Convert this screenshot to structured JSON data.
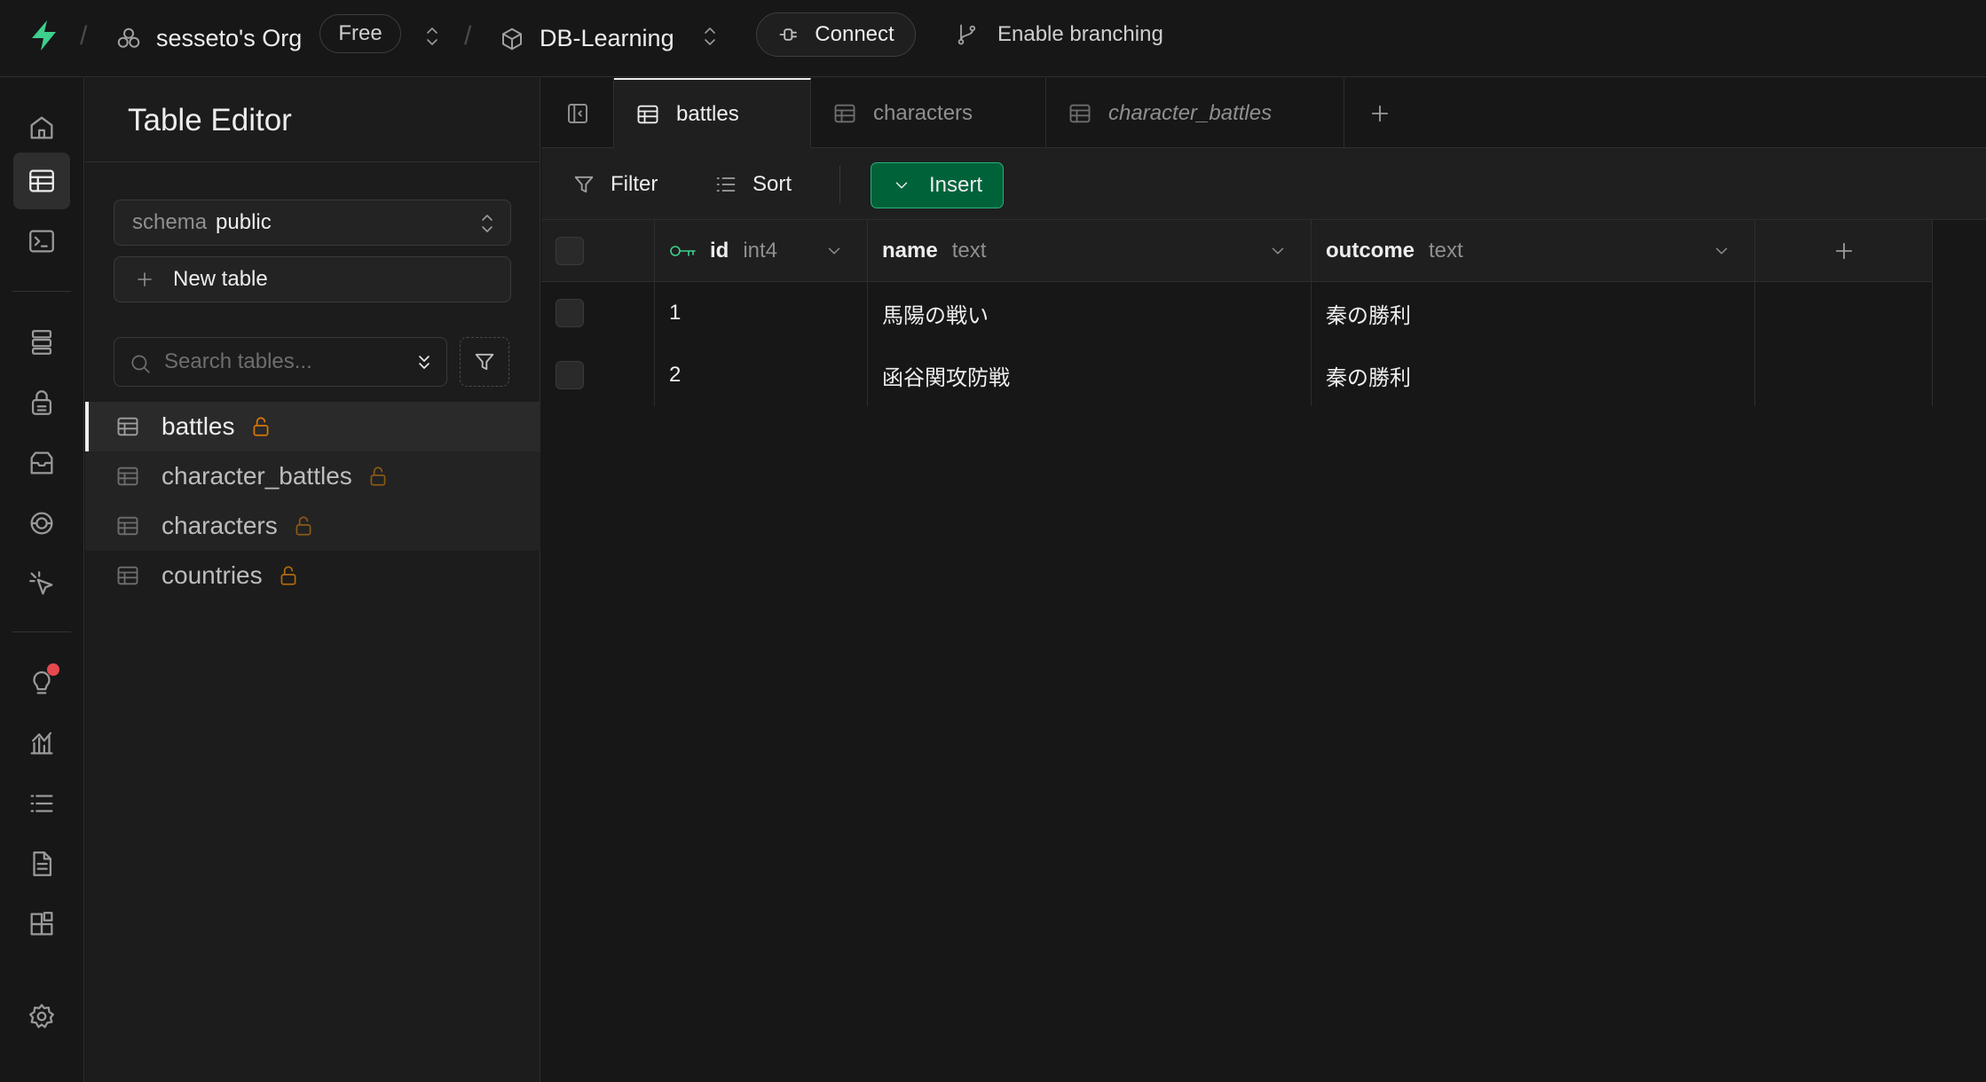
{
  "topbar": {
    "org_name": "sesseto's Org",
    "plan_badge": "Free",
    "project_name": "DB-Learning",
    "connect_label": "Connect",
    "branching_label": "Enable branching"
  },
  "rail": {
    "items": [
      "home",
      "table-editor",
      "sql-editor",
      "database",
      "authentication",
      "storage",
      "realtime",
      "edge-functions",
      "advisors",
      "reports",
      "logs",
      "api-docs",
      "integrations",
      "settings"
    ]
  },
  "sidebar": {
    "title": "Table Editor",
    "schema_label": "schema",
    "schema_value": "public",
    "new_table_label": "New table",
    "search_placeholder": "Search tables...",
    "tables": [
      {
        "name": "battles"
      },
      {
        "name": "character_battles"
      },
      {
        "name": "characters"
      },
      {
        "name": "countries"
      }
    ]
  },
  "main": {
    "tabs": [
      {
        "label": "battles"
      },
      {
        "label": "characters"
      },
      {
        "label": "character_battles"
      }
    ],
    "toolbar": {
      "filter_label": "Filter",
      "sort_label": "Sort",
      "insert_label": "Insert"
    },
    "columns": [
      {
        "name": "id",
        "type": "int4"
      },
      {
        "name": "name",
        "type": "text"
      },
      {
        "name": "outcome",
        "type": "text"
      }
    ],
    "rows": [
      {
        "id": "1",
        "name": "馬陽の戦い",
        "outcome": "秦の勝利"
      },
      {
        "id": "2",
        "name": "函谷関攻防戦",
        "outcome": "秦の勝利"
      }
    ]
  },
  "colors": {
    "accent": "#3ecf8e",
    "insert_bg": "#006239",
    "lock": "#d97706",
    "notification": "#e5484d"
  }
}
